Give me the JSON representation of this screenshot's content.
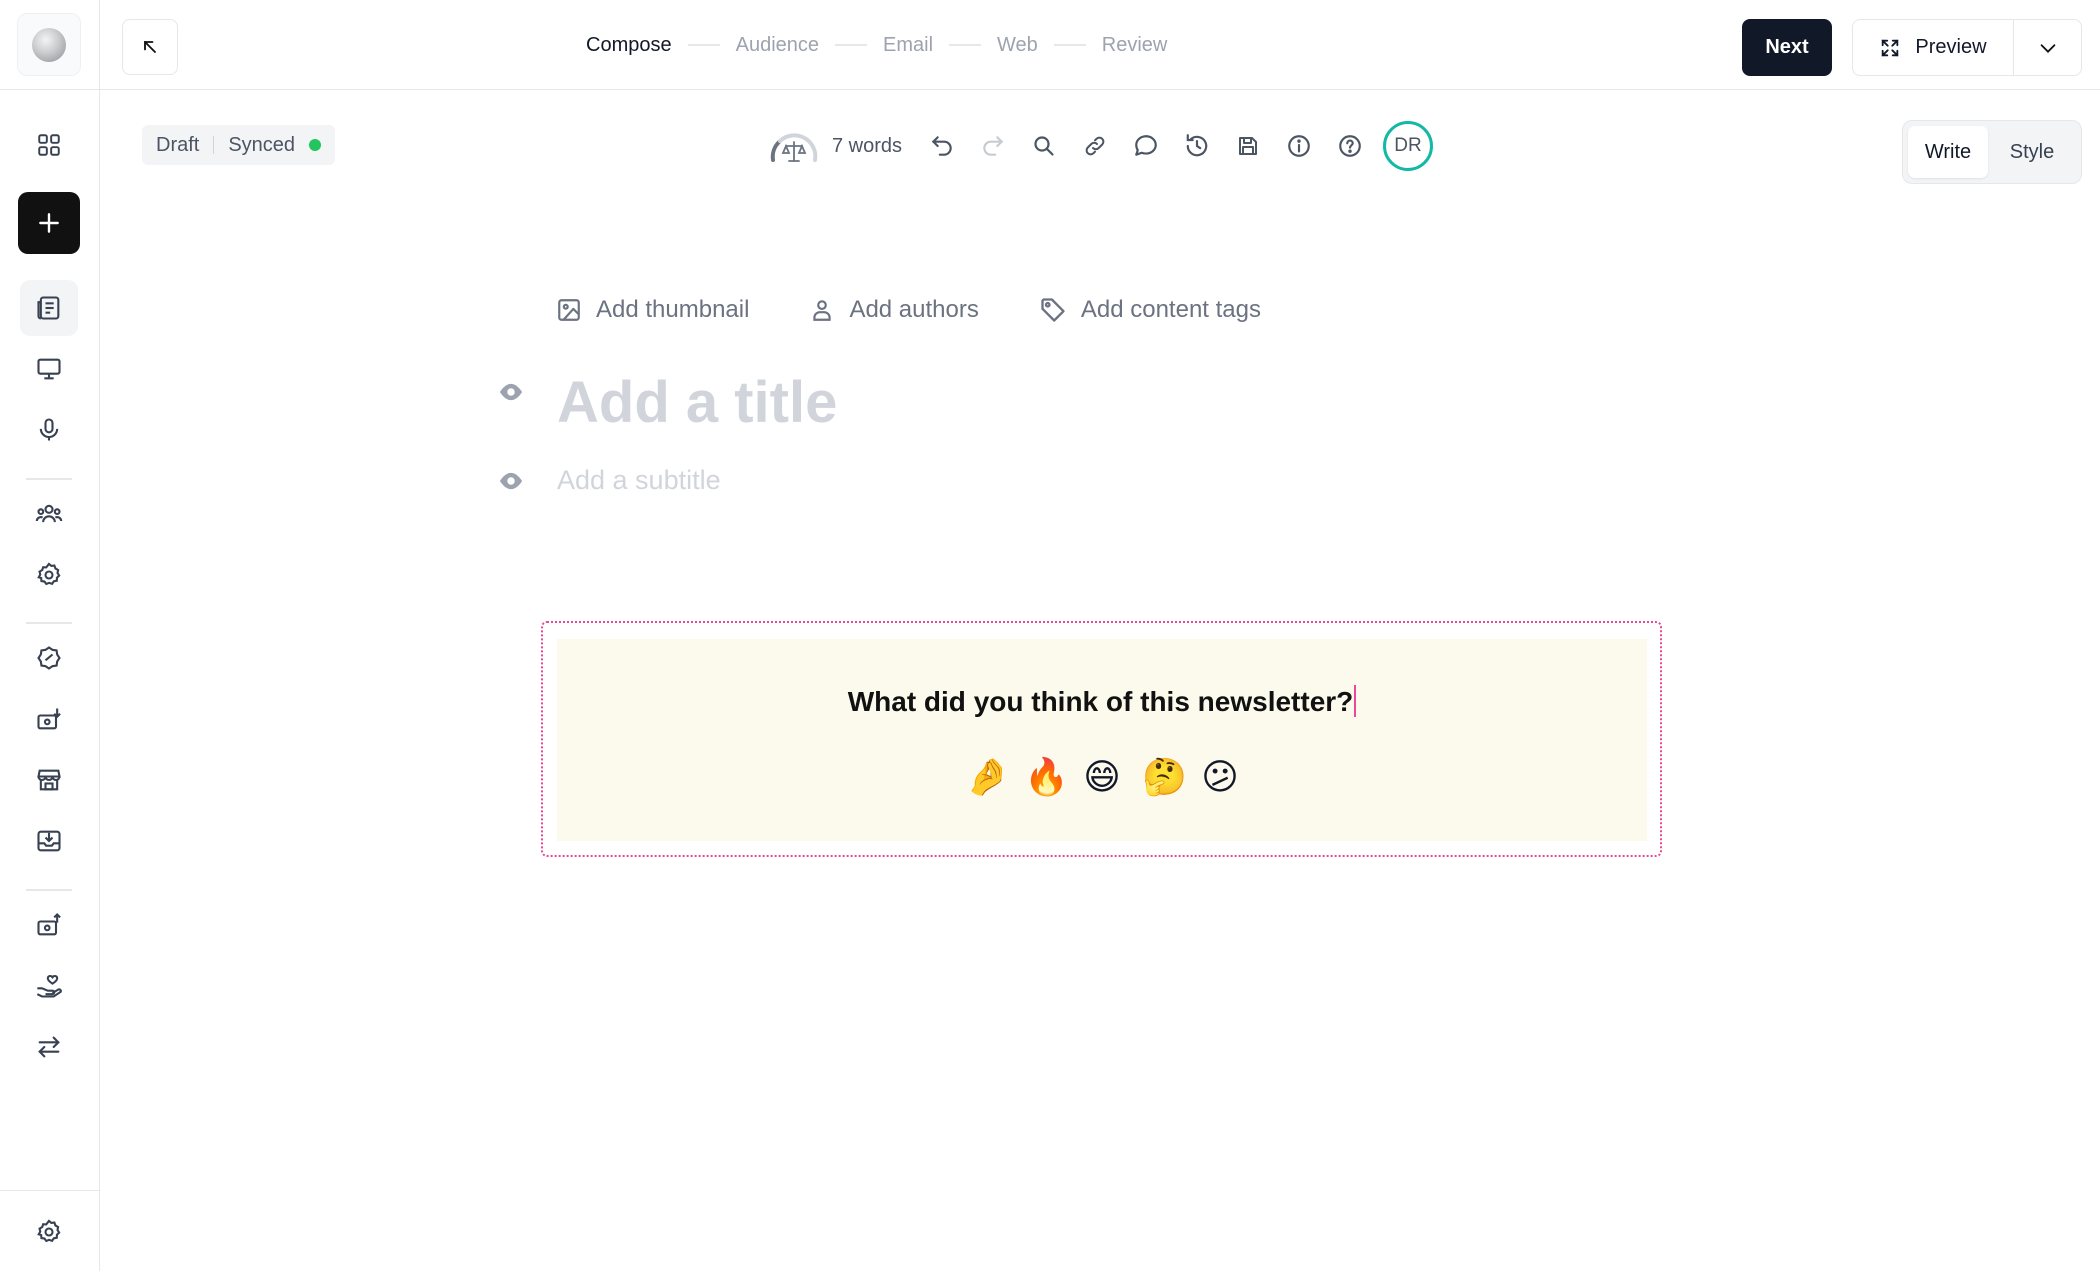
{
  "sidebar": {
    "items": [
      {
        "name": "dashboard-icon"
      },
      {
        "name": "plus-icon"
      },
      {
        "name": "posts-icon"
      },
      {
        "name": "website-icon"
      },
      {
        "name": "podcast-icon"
      },
      {
        "name": "audience-icon"
      },
      {
        "name": "settings-gear-icon"
      },
      {
        "name": "growth-icon"
      },
      {
        "name": "monetize-icon"
      },
      {
        "name": "store-icon"
      },
      {
        "name": "inbox-icon"
      },
      {
        "name": "payouts-icon"
      },
      {
        "name": "donations-icon"
      },
      {
        "name": "integrations-icon"
      },
      {
        "name": "settings-icon"
      }
    ]
  },
  "steps": [
    "Compose",
    "Audience",
    "Email",
    "Web",
    "Review"
  ],
  "current_step": "Compose",
  "top_actions": {
    "next_label": "Next",
    "preview_label": "Preview"
  },
  "status": {
    "draft_label": "Draft",
    "synced_label": "Synced",
    "synced_color": "#22c55e"
  },
  "toolbar": {
    "word_count": "7 words",
    "avatar_initials": "DR",
    "avatar_ring_color": "#14b8a6",
    "tools": [
      "undo-icon",
      "redo-icon",
      "search-icon",
      "link-icon",
      "comment-icon",
      "history-icon",
      "save-icon",
      "info-icon",
      "help-icon"
    ]
  },
  "modes": {
    "write": "Write",
    "style": "Style",
    "active": "Write"
  },
  "meta_actions": {
    "thumbnail": "Add thumbnail",
    "authors": "Add authors",
    "tags": "Add content tags"
  },
  "editor": {
    "title_placeholder": "Add a title",
    "subtitle_placeholder": "Add a subtitle"
  },
  "poll": {
    "question": "What did you think of this newsletter?",
    "options": [
      "🤌",
      "🔥",
      "😄",
      "🤔",
      "😕"
    ],
    "border_color": "#ec4899",
    "background": "#fcfaec"
  }
}
